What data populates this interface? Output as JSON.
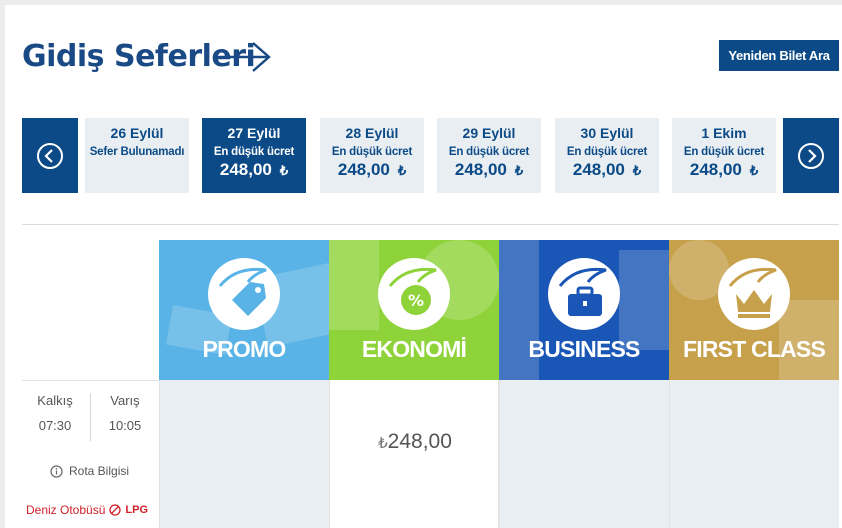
{
  "header": {
    "title": "Gidiş Seferleri",
    "new_search_label": "Yeniden Bilet Ara"
  },
  "dates": [
    {
      "date": "26 Eylül",
      "sub": "Sefer Bulunamadı",
      "price": "",
      "currency": "",
      "active": false
    },
    {
      "date": "27 Eylül",
      "sub": "En düşük ücret",
      "price": "248,00",
      "currency": "₺",
      "active": true
    },
    {
      "date": "28 Eylül",
      "sub": "En düşük ücret",
      "price": "248,00",
      "currency": "₺",
      "active": false
    },
    {
      "date": "29 Eylül",
      "sub": "En düşük ücret",
      "price": "248,00",
      "currency": "₺",
      "active": false
    },
    {
      "date": "30 Eylül",
      "sub": "En düşük ücret",
      "price": "248,00",
      "currency": "₺",
      "active": false
    },
    {
      "date": "1 Ekim",
      "sub": "En düşük ücret",
      "price": "248,00",
      "currency": "₺",
      "active": false
    }
  ],
  "classes": [
    {
      "name": "PROMO",
      "icon": "tag-icon",
      "color": "#59b3e6"
    },
    {
      "name": "EKONOMİ",
      "icon": "percent-badge-icon",
      "color": "#8fd33a"
    },
    {
      "name": "BUSINESS",
      "icon": "briefcase-icon",
      "color": "#1956b5"
    },
    {
      "name": "FIRST CLASS",
      "icon": "crown-icon",
      "color": "#c6a04b"
    }
  ],
  "trip": {
    "departure_label": "Kalkış",
    "departure_time": "07:30",
    "arrival_label": "Varış",
    "arrival_time": "10:05",
    "route_info": "Rota Bilgisi",
    "bus_type": "Deniz Otobüsü",
    "fuel": "LPG",
    "fares": {
      "promo": "",
      "ekonomi": "248,00",
      "ekonomi_currency": "₺",
      "business": "",
      "first": ""
    }
  },
  "colors": {
    "brand": "#0b4a86",
    "title": "#1a4a85",
    "accent_red": "#d0202a"
  }
}
